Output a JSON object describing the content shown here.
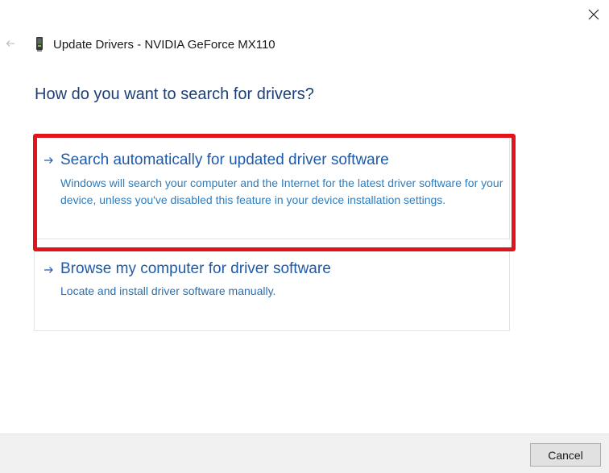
{
  "window": {
    "title": "Update Drivers - NVIDIA GeForce MX110",
    "heading": "How do you want to search for drivers?"
  },
  "icons": {
    "close": "close-icon",
    "back": "back-arrow-icon",
    "device": "graphics-card-icon",
    "option_arrow": "arrow-right-icon"
  },
  "options": [
    {
      "title": "Search automatically for updated driver software",
      "description": "Windows will search your computer and the Internet for the latest driver software for your device, unless you've disabled this feature in your device installation settings.",
      "highlighted": true
    },
    {
      "title": "Browse my computer for driver software",
      "description": "Locate and install driver software manually.",
      "highlighted": false
    }
  ],
  "footer": {
    "cancel_label": "Cancel"
  },
  "colors": {
    "heading": "#1d3f73",
    "option_title": "#1e5aa8",
    "option_desc": "#2d7dbf",
    "highlight": "#e2141b",
    "footer_bg": "#f0f0f0"
  }
}
